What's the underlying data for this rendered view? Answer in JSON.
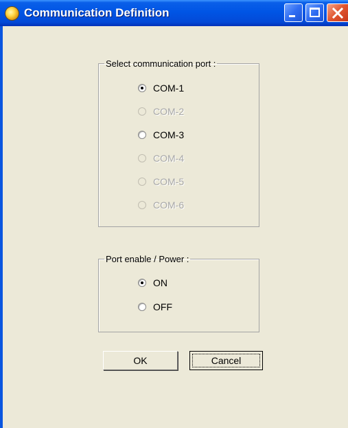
{
  "window": {
    "title": "Communication Definition",
    "icon": "app-globe-icon",
    "controls": {
      "minimize_icon": "minimize-icon",
      "maximize_icon": "maximize-icon",
      "close_icon": "close-icon"
    }
  },
  "port_group": {
    "legend": "Select communication port :",
    "options": [
      {
        "label": "COM-1",
        "selected": true,
        "enabled": true
      },
      {
        "label": "COM-2",
        "selected": false,
        "enabled": false
      },
      {
        "label": "COM-3",
        "selected": false,
        "enabled": true
      },
      {
        "label": "COM-4",
        "selected": false,
        "enabled": false
      },
      {
        "label": "COM-5",
        "selected": false,
        "enabled": false
      },
      {
        "label": "COM-6",
        "selected": false,
        "enabled": false
      }
    ]
  },
  "power_group": {
    "legend": "Port enable / Power :",
    "options": [
      {
        "label": "ON",
        "selected": true,
        "enabled": true
      },
      {
        "label": "OFF",
        "selected": false,
        "enabled": true
      }
    ]
  },
  "buttons": {
    "ok": "OK",
    "cancel": "Cancel"
  },
  "colors": {
    "dialog_background": "#ece9d8",
    "titlebar_blue": "#0055e5",
    "close_red": "#e0552f",
    "disabled_text": "#a8a8a8"
  }
}
